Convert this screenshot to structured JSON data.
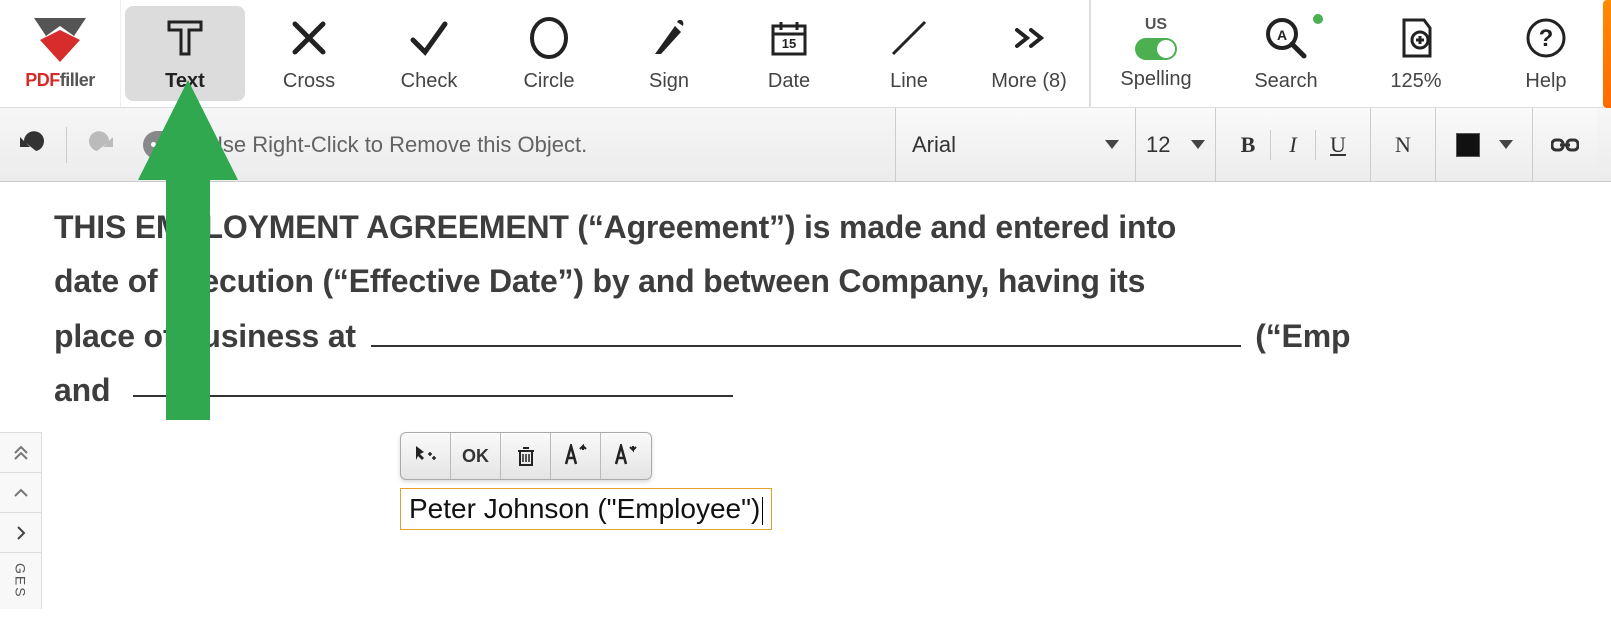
{
  "logo": {
    "pdf": "PDF",
    "filler": "filler"
  },
  "tools": {
    "text": "Text",
    "cross": "Cross",
    "check": "Check",
    "circle": "Circle",
    "sign": "Sign",
    "date": "Date",
    "line": "Line",
    "more": "More (8)"
  },
  "right_tools": {
    "spelling_locale": "US",
    "spelling": "Spelling",
    "search": "Search",
    "zoom": "125%",
    "help": "Help"
  },
  "second_bar": {
    "hint": "Use Right-Click to Remove this Object.",
    "font": "Arial",
    "size": "12",
    "bold": "B",
    "italic": "I",
    "underline": "U",
    "normal": "N"
  },
  "document": {
    "line1": "THIS EMPLOYMENT AGREEMENT (“Agreement”) is made and entered into",
    "line2": "date of execution (“Effective Date”) by and between Company, having its",
    "line3_before": "place of business at",
    "line3_after": "(“Emp",
    "line4": "and"
  },
  "float_toolbar": {
    "ok": "OK"
  },
  "text_box": {
    "value": "Peter Johnson (\"Employee\")"
  },
  "side_panel": {
    "label": "GES"
  }
}
